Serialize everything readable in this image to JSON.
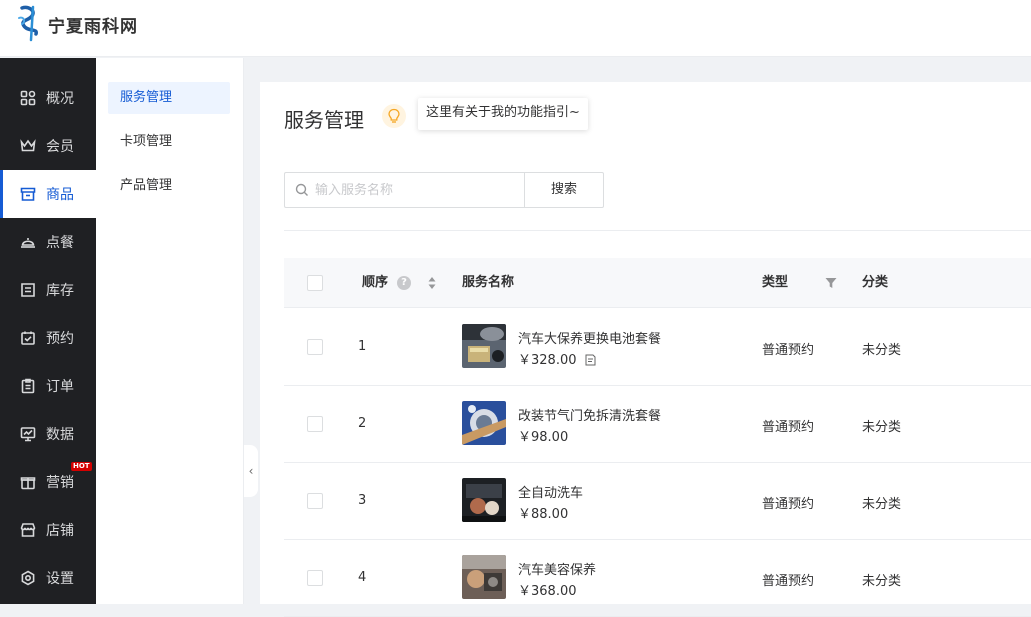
{
  "brand": {
    "name": "宁夏雨科网"
  },
  "nav": {
    "items": [
      {
        "label": "概况",
        "icon": "grid-icon"
      },
      {
        "label": "会员",
        "icon": "crown-icon"
      },
      {
        "label": "商品",
        "icon": "store-icon",
        "active": true
      },
      {
        "label": "点餐",
        "icon": "dish-icon"
      },
      {
        "label": "库存",
        "icon": "inventory-icon"
      },
      {
        "label": "预约",
        "icon": "calendar-check-icon"
      },
      {
        "label": "订单",
        "icon": "clipboard-icon"
      },
      {
        "label": "数据",
        "icon": "monitor-chart-icon"
      },
      {
        "label": "营销",
        "icon": "gift-icon",
        "badge": "HOT"
      },
      {
        "label": "店铺",
        "icon": "shop-icon"
      },
      {
        "label": "设置",
        "icon": "gear-icon"
      }
    ]
  },
  "subnav": {
    "items": [
      {
        "label": "服务管理",
        "active": true
      },
      {
        "label": "卡项管理"
      },
      {
        "label": "产品管理"
      }
    ],
    "collapse_glyph": "‹"
  },
  "main": {
    "title": "服务管理",
    "tip": "这里有关于我的功能指引~",
    "search": {
      "placeholder": "输入服务名称",
      "value": "",
      "button_label": "搜索"
    },
    "table": {
      "columns": {
        "order": "顺序",
        "name": "服务名称",
        "type": "类型",
        "category": "分类"
      },
      "rows": [
        {
          "order": "1",
          "name": "汽车大保养更换电池套餐",
          "price": "￥328.00",
          "type": "普通预约",
          "category": "未分类",
          "has_doc_icon": true
        },
        {
          "order": "2",
          "name": "改装节气门免拆清洗套餐",
          "price": "￥98.00",
          "type": "普通预约",
          "category": "未分类"
        },
        {
          "order": "3",
          "name": "全自动洗车",
          "price": "￥88.00",
          "type": "普通预约",
          "category": "未分类"
        },
        {
          "order": "4",
          "name": "汽车美容保养",
          "price": "￥368.00",
          "type": "普通预约",
          "category": "未分类"
        }
      ]
    }
  },
  "colors": {
    "accent": "#155bd4",
    "nav_bg": "#1f2023",
    "hot_badge": "#d40000"
  }
}
